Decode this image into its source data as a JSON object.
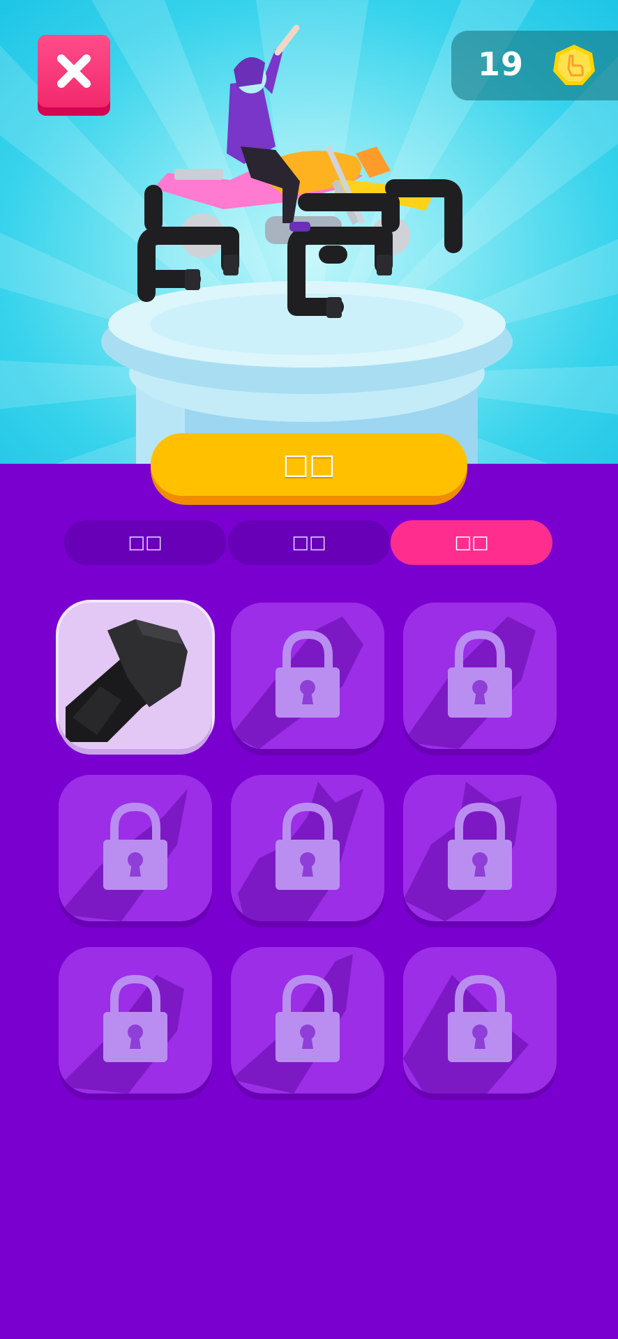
{
  "header": {
    "close_icon": "close-icon",
    "coins": "19",
    "coin_icon": "coin-icon"
  },
  "action_button": {
    "label": "□□"
  },
  "tabs": [
    {
      "label": "□□",
      "active": false
    },
    {
      "label": "□□",
      "active": false
    },
    {
      "label": "□□",
      "active": true
    }
  ],
  "grid": {
    "items": [
      {
        "state": "unlocked",
        "selected": true,
        "icon": "pipe-wheel-icon"
      },
      {
        "state": "locked",
        "icon": "lock-icon"
      },
      {
        "state": "locked",
        "icon": "lock-icon"
      },
      {
        "state": "locked",
        "icon": "lock-icon"
      },
      {
        "state": "locked",
        "icon": "lock-icon"
      },
      {
        "state": "locked",
        "icon": "lock-icon"
      },
      {
        "state": "locked",
        "icon": "lock-icon"
      },
      {
        "state": "locked",
        "icon": "lock-icon"
      },
      {
        "state": "locked",
        "icon": "lock-icon"
      }
    ]
  },
  "colors": {
    "background": "#7a00cf",
    "sky": "#38d3ec",
    "accent_pink": "#ff2d8e",
    "button_yellow": "#ffc000",
    "close_red": "#f2296c"
  }
}
